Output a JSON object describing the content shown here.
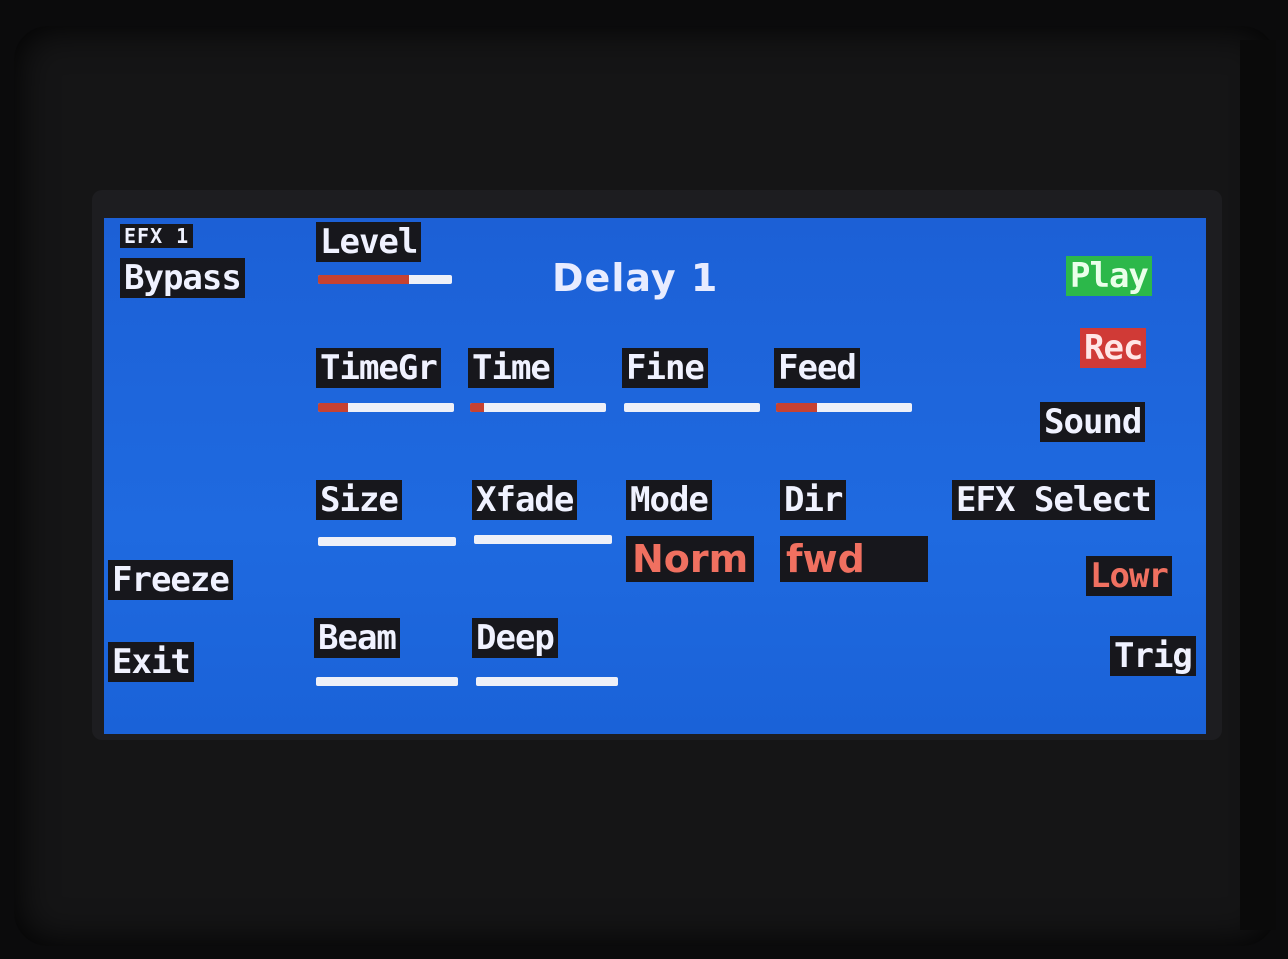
{
  "efx_slot": "EFX 1",
  "effect_title": "Delay 1",
  "left_buttons": {
    "bypass": "Bypass",
    "freeze": "Freeze",
    "exit": "Exit"
  },
  "right_buttons": {
    "play": "Play",
    "rec": "Rec",
    "sound": "Sound",
    "efx_select": "EFX Select",
    "lowr": "Lowr",
    "trig": "Trig"
  },
  "params": {
    "level": {
      "label": "Level",
      "value_fraction": 0.68
    },
    "timegr": {
      "label": "TimeGr",
      "value_fraction": 0.22
    },
    "time": {
      "label": "Time",
      "value_fraction": 0.1
    },
    "fine": {
      "label": "Fine",
      "value_fraction": 0.0
    },
    "feed": {
      "label": "Feed",
      "value_fraction": 0.3
    },
    "size": {
      "label": "Size",
      "value_fraction": 0.0
    },
    "xfade": {
      "label": "Xfade",
      "value_fraction": 0.0
    },
    "mode": {
      "label": "Mode",
      "value": "Norm"
    },
    "dir": {
      "label": "Dir",
      "value": "fwd"
    },
    "beam": {
      "label": "Beam",
      "value_fraction": 0.0
    },
    "deep": {
      "label": "Deep",
      "value_fraction": 0.0
    }
  },
  "colors": {
    "screen_bg": "#1c64d8",
    "label_bg": "#17171c",
    "bar_fill": "#c64232",
    "play": "#2cb84a",
    "rec": "#d03a36",
    "value_text": "#f07060"
  }
}
